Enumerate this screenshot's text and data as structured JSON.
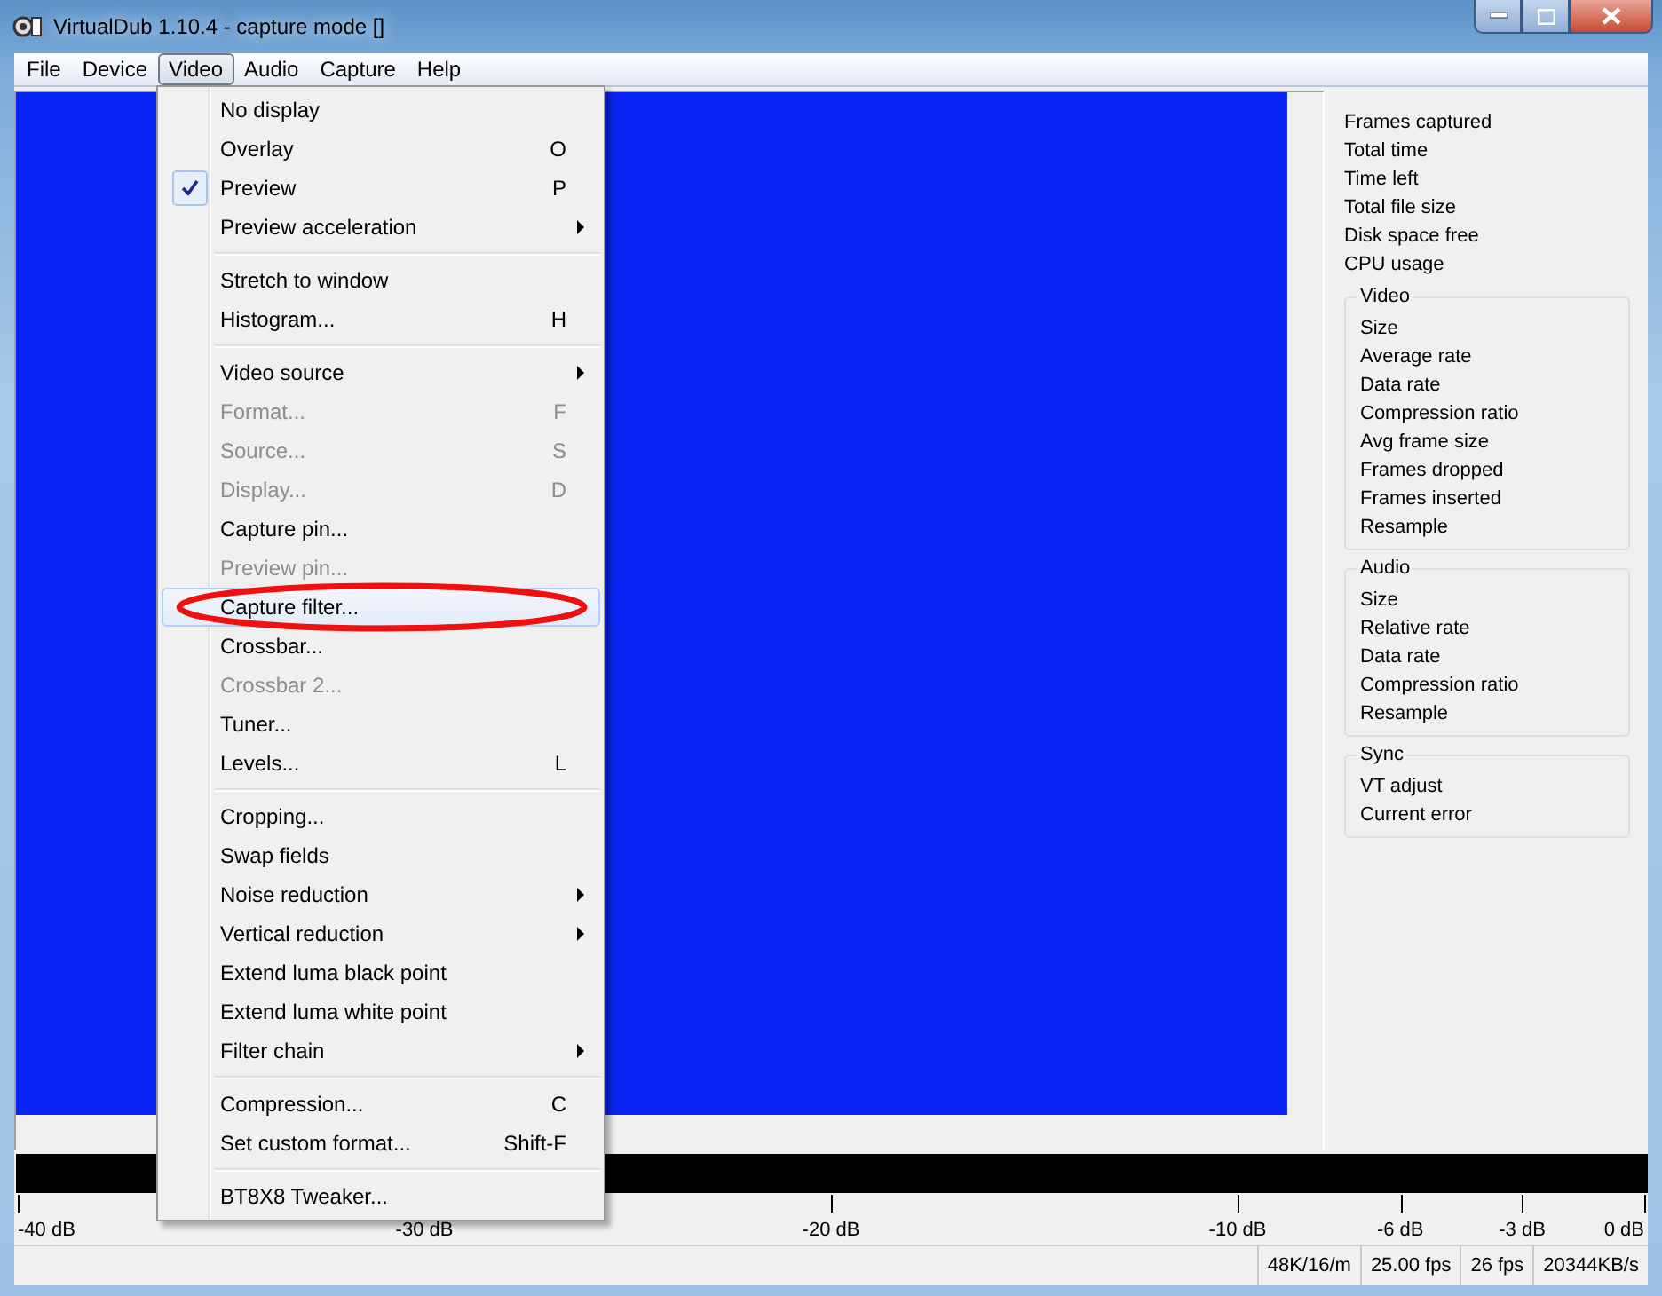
{
  "window": {
    "title": "VirtualDub 1.10.4 - capture mode []"
  },
  "menubar": [
    {
      "label": "File",
      "selected": false
    },
    {
      "label": "Device",
      "selected": false
    },
    {
      "label": "Video",
      "selected": true
    },
    {
      "label": "Audio",
      "selected": false
    },
    {
      "label": "Capture",
      "selected": false
    },
    {
      "label": "Help",
      "selected": false
    }
  ],
  "video_menu": [
    {
      "kind": "item",
      "label": "No display",
      "submenu": false,
      "disabled": false,
      "checked": false,
      "selected": false
    },
    {
      "kind": "item",
      "label": "Overlay",
      "shortcut": "O",
      "submenu": false,
      "disabled": false,
      "checked": false,
      "selected": false
    },
    {
      "kind": "item",
      "label": "Preview",
      "shortcut": "P",
      "submenu": false,
      "disabled": false,
      "checked": true,
      "selected": false
    },
    {
      "kind": "item",
      "label": "Preview acceleration",
      "submenu": true,
      "disabled": false,
      "checked": false,
      "selected": false
    },
    {
      "kind": "separator"
    },
    {
      "kind": "item",
      "label": "Stretch to window",
      "submenu": false,
      "disabled": false,
      "checked": false,
      "selected": false
    },
    {
      "kind": "item",
      "label": "Histogram...",
      "shortcut": "H",
      "submenu": false,
      "disabled": false,
      "checked": false,
      "selected": false
    },
    {
      "kind": "separator"
    },
    {
      "kind": "item",
      "label": "Video source",
      "submenu": true,
      "disabled": false,
      "checked": false,
      "selected": false
    },
    {
      "kind": "item",
      "label": "Format...",
      "shortcut": "F",
      "submenu": false,
      "disabled": true,
      "checked": false,
      "selected": false
    },
    {
      "kind": "item",
      "label": "Source...",
      "shortcut": "S",
      "submenu": false,
      "disabled": true,
      "checked": false,
      "selected": false
    },
    {
      "kind": "item",
      "label": "Display...",
      "shortcut": "D",
      "submenu": false,
      "disabled": true,
      "checked": false,
      "selected": false
    },
    {
      "kind": "item",
      "label": "Capture pin...",
      "submenu": false,
      "disabled": false,
      "checked": false,
      "selected": false
    },
    {
      "kind": "item",
      "label": "Preview pin...",
      "submenu": false,
      "disabled": true,
      "checked": false,
      "selected": false
    },
    {
      "kind": "item",
      "label": "Capture filter...",
      "submenu": false,
      "disabled": false,
      "checked": false,
      "selected": true,
      "circled": true
    },
    {
      "kind": "item",
      "label": "Crossbar...",
      "submenu": false,
      "disabled": false,
      "checked": false,
      "selected": false
    },
    {
      "kind": "item",
      "label": "Crossbar 2...",
      "submenu": false,
      "disabled": true,
      "checked": false,
      "selected": false
    },
    {
      "kind": "item",
      "label": "Tuner...",
      "submenu": false,
      "disabled": false,
      "checked": false,
      "selected": false
    },
    {
      "kind": "item",
      "label": "Levels...",
      "shortcut": "L",
      "submenu": false,
      "disabled": false,
      "checked": false,
      "selected": false
    },
    {
      "kind": "separator"
    },
    {
      "kind": "item",
      "label": "Cropping...",
      "submenu": false,
      "disabled": false,
      "checked": false,
      "selected": false
    },
    {
      "kind": "item",
      "label": "Swap fields",
      "submenu": false,
      "disabled": false,
      "checked": false,
      "selected": false
    },
    {
      "kind": "item",
      "label": "Noise reduction",
      "submenu": true,
      "disabled": false,
      "checked": false,
      "selected": false
    },
    {
      "kind": "item",
      "label": "Vertical reduction",
      "submenu": true,
      "disabled": false,
      "checked": false,
      "selected": false
    },
    {
      "kind": "item",
      "label": "Extend luma black point",
      "submenu": false,
      "disabled": false,
      "checked": false,
      "selected": false
    },
    {
      "kind": "item",
      "label": "Extend luma white point",
      "submenu": false,
      "disabled": false,
      "checked": false,
      "selected": false
    },
    {
      "kind": "item",
      "label": "Filter chain",
      "submenu": true,
      "disabled": false,
      "checked": false,
      "selected": false
    },
    {
      "kind": "separator"
    },
    {
      "kind": "item",
      "label": "Compression...",
      "shortcut": "C",
      "submenu": false,
      "disabled": false,
      "checked": false,
      "selected": false
    },
    {
      "kind": "item",
      "label": "Set custom format...",
      "shortcut": "Shift-F",
      "submenu": false,
      "disabled": false,
      "checked": false,
      "selected": false
    },
    {
      "kind": "separator"
    },
    {
      "kind": "item",
      "label": "BT8X8 Tweaker...",
      "submenu": false,
      "disabled": false,
      "checked": false,
      "selected": false
    }
  ],
  "stats": {
    "items": [
      "Frames captured",
      "Total time",
      "Time left",
      "Total file size",
      "Disk space free",
      "CPU usage"
    ],
    "groups": [
      {
        "title": "Video",
        "items": [
          "Size",
          "Average rate",
          "Data rate",
          "Compression ratio",
          "Avg frame size",
          "Frames dropped",
          "Frames inserted",
          "Resample"
        ]
      },
      {
        "title": "Audio",
        "items": [
          "Size",
          "Relative rate",
          "Data rate",
          "Compression ratio",
          "Resample"
        ]
      },
      {
        "title": "Sync",
        "items": [
          "VT adjust",
          "Current error"
        ]
      }
    ]
  },
  "meter_scale": [
    "-40 dB",
    "-30 dB",
    "-20 dB",
    "-10 dB",
    "-6 dB",
    "-3 dB",
    "0 dB"
  ],
  "status_bar": [
    "48K/16/m",
    "25.00 fps",
    "26 fps",
    "20344KB/s"
  ]
}
